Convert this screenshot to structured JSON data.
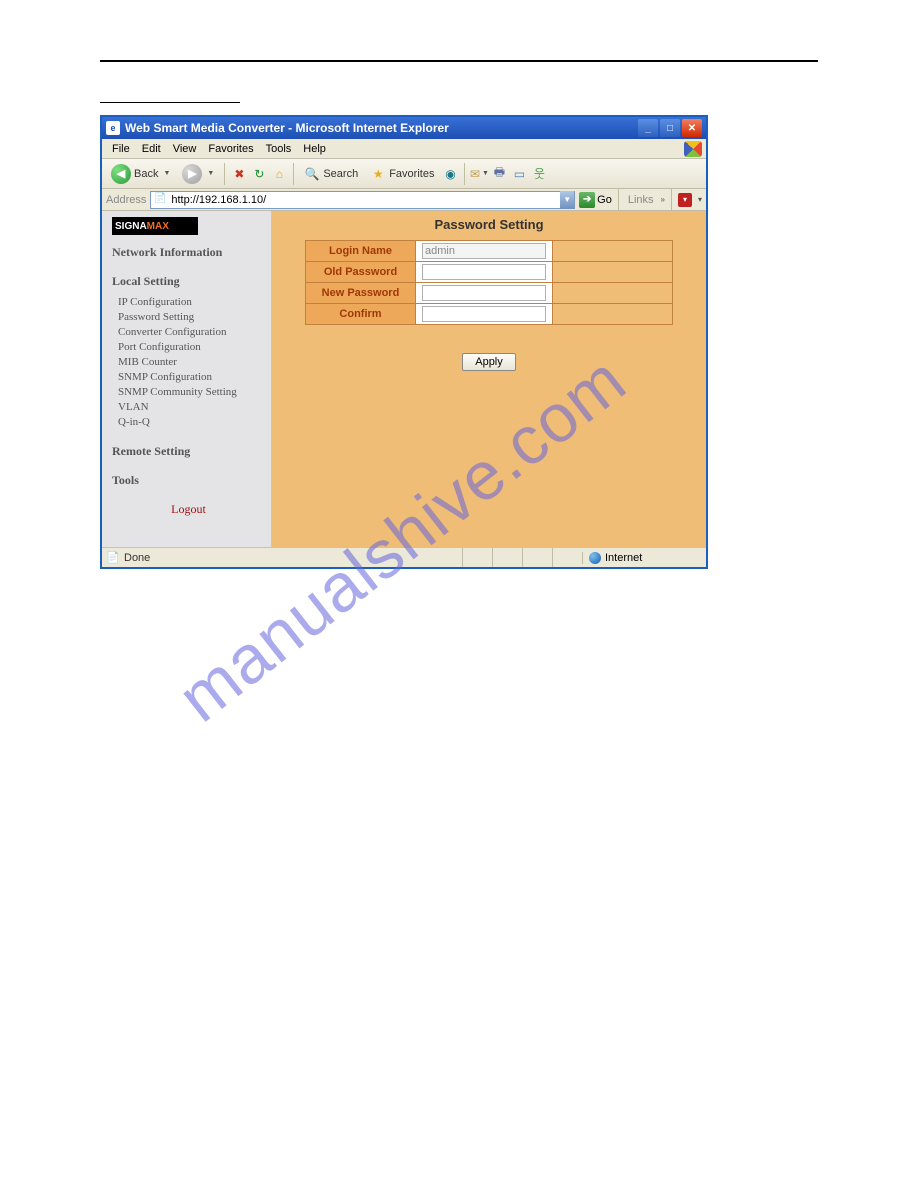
{
  "window": {
    "title": "Web Smart Media Converter - Microsoft Internet Explorer"
  },
  "menubar": {
    "file": "File",
    "edit": "Edit",
    "view": "View",
    "favorites": "Favorites",
    "tools": "Tools",
    "help": "Help"
  },
  "toolbar": {
    "back": "Back",
    "search": "Search",
    "favorites": "Favorites"
  },
  "addressbar": {
    "label": "Address",
    "url": "http://192.168.1.10/",
    "go": "Go",
    "links": "Links"
  },
  "sidebar": {
    "logo_left": "SIGNA",
    "logo_right": "MAX",
    "heads": {
      "network": "Network Information",
      "local": "Local Setting",
      "remote": "Remote Setting",
      "tools": "Tools"
    },
    "local_items": [
      "IP Configuration",
      "Password Setting",
      "Converter Configuration",
      "Port Configuration",
      "MIB Counter",
      "SNMP Configuration",
      "SNMP Community Setting",
      "VLAN",
      "Q-in-Q"
    ],
    "logout": "Logout"
  },
  "main": {
    "title": "Password Setting",
    "rows": {
      "login": "Login Name",
      "old": "Old Password",
      "new": "New Password",
      "confirm": "Confirm"
    },
    "login_value": "admin",
    "apply": "Apply"
  },
  "statusbar": {
    "done": "Done",
    "zone": "Internet"
  },
  "watermark": "manualshive.com"
}
